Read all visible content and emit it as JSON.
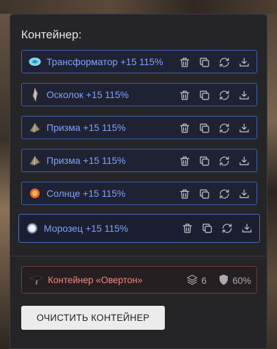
{
  "panel": {
    "title": "Контейнер:",
    "items": [
      {
        "label": "Трансформатор +15 115%",
        "icon": "transformer-icon"
      },
      {
        "label": "Осколок +15 115%",
        "icon": "shard-icon"
      },
      {
        "label": "Призма +15 115%",
        "icon": "prism-icon"
      },
      {
        "label": "Призма +15 115%",
        "icon": "prism-icon"
      },
      {
        "label": "Солнце +15 115%",
        "icon": "sun-icon"
      },
      {
        "label": "Морозец +15 115%",
        "icon": "frost-icon"
      }
    ],
    "row_actions": [
      "trash-icon",
      "copy-icon",
      "refresh-icon",
      "download-icon"
    ],
    "bundle": {
      "label": "Контейнер «Овертон»",
      "layers_count": "6",
      "shield_percent": "60%"
    },
    "clear_button": "ОЧИСТИТЬ КОНТЕЙНЕР"
  },
  "colors": {
    "panel_bg": "#252528",
    "row_border": "#3e5fae",
    "row_text": "#7fa3f5",
    "bundle_text": "#f08a80",
    "bundle_border": "#6b3c3c"
  }
}
